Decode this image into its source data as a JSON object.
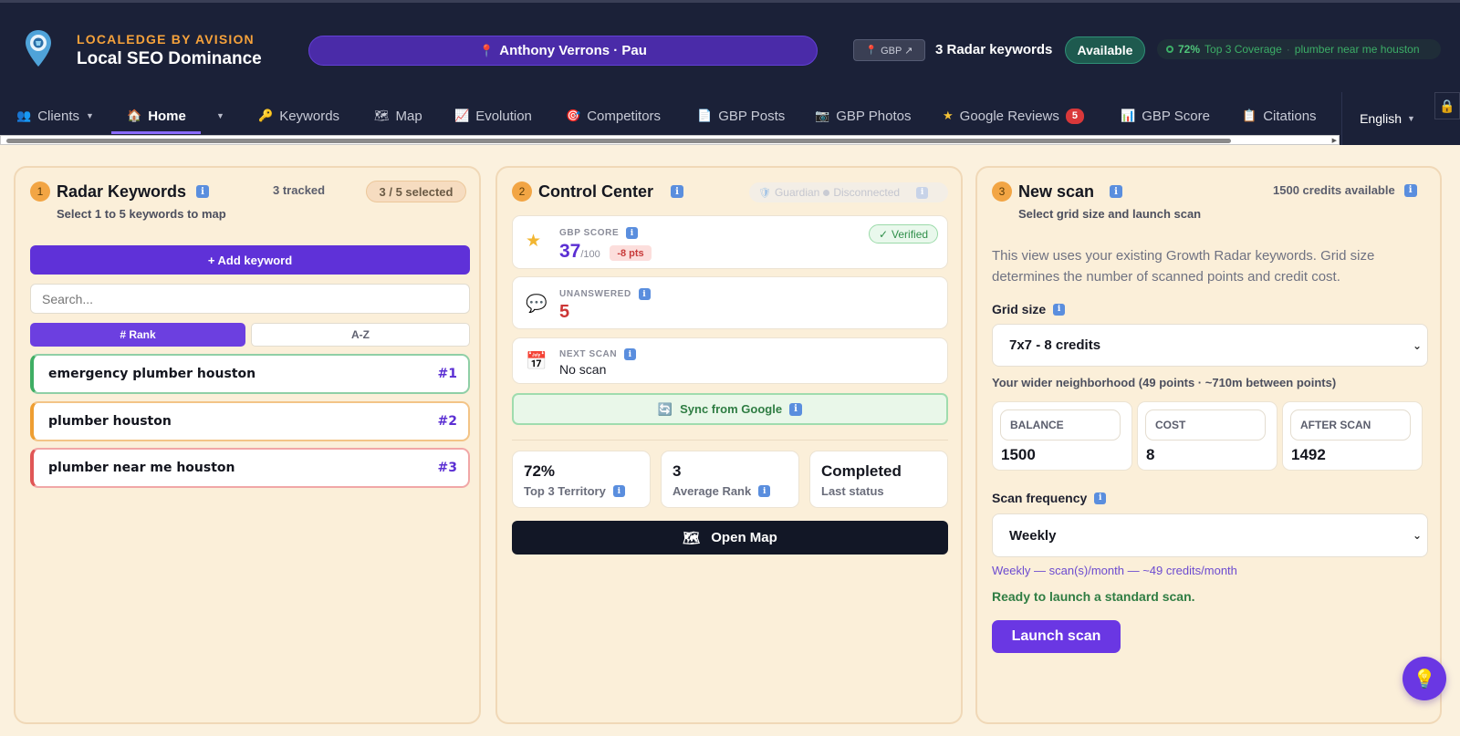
{
  "header": {
    "brand_top": "LOCALEDGE BY AVISION",
    "brand_main": "Local SEO Dominance",
    "client": "Anthony Verrons · Pau",
    "gbp_label": "GBP ↗",
    "radar_keywords": "3 Radar keywords",
    "status": "Available",
    "coverage_pct": "72%",
    "coverage_label": "Top 3 Coverage",
    "coverage_separator": "·",
    "coverage_keyword": "plumber near me houston"
  },
  "nav": {
    "items": [
      {
        "label": "Clients",
        "icon": "users-icon"
      },
      {
        "label": "Home",
        "icon": "home-icon"
      },
      {
        "label": "Keywords",
        "icon": "key-icon"
      },
      {
        "label": "Map",
        "icon": "map-icon"
      },
      {
        "label": "Evolution",
        "icon": "chart-icon"
      },
      {
        "label": "Competitors",
        "icon": "target-icon"
      },
      {
        "label": "GBP Posts",
        "icon": "document-icon"
      },
      {
        "label": "GBP Photos",
        "icon": "camera-icon"
      },
      {
        "label": "Google Reviews",
        "icon": "star-icon"
      },
      {
        "label": "GBP Score",
        "icon": "bar-chart-icon"
      },
      {
        "label": "Citations",
        "icon": "clipboard-icon"
      }
    ],
    "reviews_badge": "5",
    "language": "English"
  },
  "card1": {
    "step": "1",
    "title": "Radar Keywords",
    "subtitle": "Select 1 to 5 keywords to map",
    "tracked": "3 tracked",
    "selected": "3 / 5 selected",
    "add_keyword": "+ Add keyword",
    "search_placeholder": "Search...",
    "sort_rank": "# Rank",
    "sort_az": "A-Z",
    "keywords": [
      {
        "name": "emergency plumber houston",
        "rank": "#1"
      },
      {
        "name": "plumber houston",
        "rank": "#2"
      },
      {
        "name": "plumber near me houston",
        "rank": "#3"
      }
    ]
  },
  "card2": {
    "step": "2",
    "title": "Control Center",
    "guardian": "Guardian",
    "guardian_status": "Disconnected",
    "gbp_score_label": "GBP SCORE",
    "gbp_score": "37",
    "gbp_score_max": "/100",
    "gbp_delta": "-8 pts",
    "verified": "Verified",
    "unanswered_label": "UNANSWERED",
    "unanswered": "5",
    "next_scan_label": "NEXT SCAN",
    "next_scan": "No scan",
    "sync": "Sync from Google",
    "stats": [
      {
        "value": "72%",
        "label": "Top 3 Territory"
      },
      {
        "value": "3",
        "label": "Average Rank"
      },
      {
        "value": "Completed",
        "label": "Last status"
      }
    ],
    "open_map": "Open Map"
  },
  "card3": {
    "step": "3",
    "title": "New scan",
    "subtitle": "Select grid size and launch scan",
    "credits": "1500 credits available",
    "description": "This view uses your existing Growth Radar keywords. Grid size determines the number of scanned points and credit cost.",
    "grid_size_label": "Grid size",
    "grid_size": "7x7 - 8 credits",
    "neighborhood": "Your wider neighborhood (49 points · ~710m between points)",
    "balance_label": "BALANCE",
    "balance": "1500",
    "cost_label": "COST",
    "cost": "8",
    "after_label": "AFTER SCAN",
    "after": "1492",
    "frequency_label": "Scan frequency",
    "frequency": "Weekly",
    "frequency_note": "Weekly — scan(s)/month — ~49 credits/month",
    "ready": "Ready to launch a standard scan.",
    "launch": "Launch scan"
  },
  "colors": {
    "header_bg": "#1b2138",
    "accent_purple": "#5f31d8",
    "brand_orange": "#f6a23b",
    "card_bg": "#fbefd9",
    "success_green": "#2f7d43",
    "danger_red": "#cc3636"
  }
}
